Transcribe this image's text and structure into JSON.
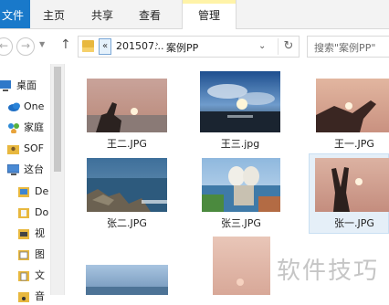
{
  "ribbon": {
    "file": "文件",
    "tabs": [
      "主页",
      "共享",
      "查看"
    ],
    "manage": "管理"
  },
  "address": {
    "chevron": "«",
    "crumbs": [
      "201507...",
      "案例PP"
    ],
    "separator": "›"
  },
  "search": {
    "placeholder": "搜索\"案例PP\""
  },
  "sidebar": {
    "items": [
      {
        "label": "桌面",
        "icon": "desktop-icon"
      },
      {
        "label": "One",
        "icon": "onedrive-icon"
      },
      {
        "label": "家庭",
        "icon": "homegroup-icon"
      },
      {
        "label": "SOF",
        "icon": "user-folder-icon"
      },
      {
        "label": "这台",
        "icon": "this-pc-icon"
      },
      {
        "label": "De",
        "icon": "folder-icon"
      },
      {
        "label": "Do",
        "icon": "folder-icon"
      },
      {
        "label": "视",
        "icon": "video-folder-icon"
      },
      {
        "label": "图",
        "icon": "picture-folder-icon"
      },
      {
        "label": "文",
        "icon": "document-folder-icon"
      },
      {
        "label": "音",
        "icon": "music-folder-icon"
      }
    ]
  },
  "files": [
    {
      "name": "王二.JPG"
    },
    {
      "name": "王三.jpg"
    },
    {
      "name": "王一.JPG"
    },
    {
      "name": "张二.JPG"
    },
    {
      "name": "张三.JPG"
    },
    {
      "name": "张一.JPG",
      "selected": true
    },
    {
      "name": ""
    },
    {
      "name": ""
    }
  ],
  "watermark": "软件技巧"
}
